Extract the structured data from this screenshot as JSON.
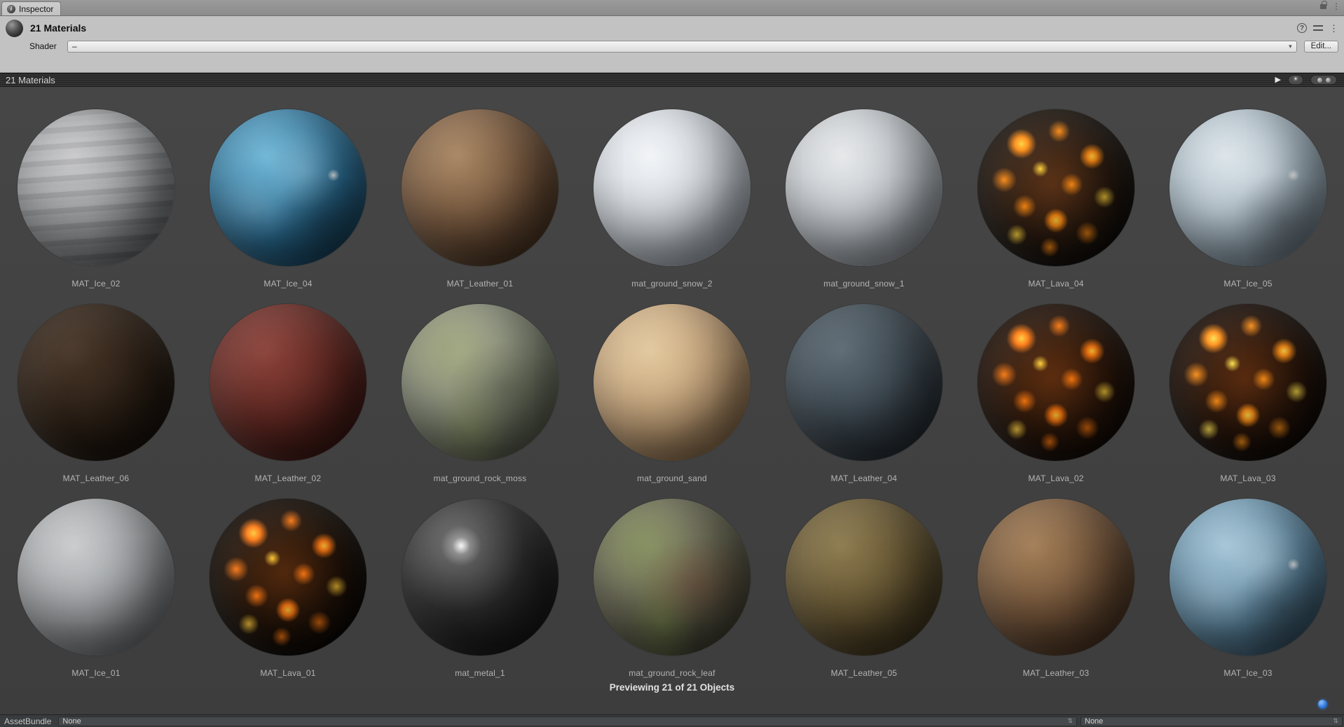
{
  "window": {
    "tab": "Inspector"
  },
  "header": {
    "title": "21 Materials",
    "shader_label": "Shader",
    "shader_value": "–",
    "edit_button": "Edit..."
  },
  "preview": {
    "title": "21 Materials",
    "status": "Previewing 21 of 21 Objects"
  },
  "assetbundle": {
    "label": "AssetBundle",
    "name_value": "None",
    "variant_value": "None"
  },
  "icons": {
    "menu": "⋮",
    "inspector_tab": "i",
    "help": "?",
    "dropdown": "▾",
    "play": "▶",
    "lighting": "☀",
    "popup": "⇅"
  },
  "colors": {
    "preview_background": "#414141",
    "header_background": "#c2c2c2",
    "splitter_background": "#2b2b2b",
    "label_text": "#b4b4b4",
    "notification_blue": "#2f7bd9"
  },
  "materials": [
    {
      "name": "MAT_Ice_02",
      "kind": "banded",
      "hi": "#c6c6c8",
      "base": "#96989a",
      "dark": "#4e5052"
    },
    {
      "name": "MAT_Ice_04",
      "kind": "marble",
      "hi": "#6fb6d6",
      "base": "#2a6c92",
      "dark": "#0e2f44"
    },
    {
      "name": "MAT_Leather_01",
      "kind": "plain",
      "hi": "#a88662",
      "base": "#70523a",
      "dark": "#352414"
    },
    {
      "name": "mat_ground_snow_2",
      "kind": "plain",
      "hi": "#f2f4f7",
      "base": "#ced4da",
      "dark": "#878e98"
    },
    {
      "name": "mat_ground_snow_1",
      "kind": "plain",
      "hi": "#e6e8ea",
      "base": "#bfc4c9",
      "dark": "#767c84"
    },
    {
      "name": "MAT_Lava_04",
      "kind": "lava",
      "hi": "#3a2f24",
      "base": "#26201a",
      "dark": "#0c0a08",
      "g1": "#ff8c14",
      "g2": "#ffd23c"
    },
    {
      "name": "MAT_Ice_05",
      "kind": "marble",
      "hi": "#dde5ea",
      "base": "#a4b6c2",
      "dark": "#5f6e7a"
    },
    {
      "name": "MAT_Leather_06",
      "kind": "plain",
      "hi": "#473527",
      "base": "#2b1f15",
      "dark": "#0f0a06"
    },
    {
      "name": "MAT_Leather_02",
      "kind": "plain",
      "hi": "#8a423a",
      "base": "#5e2620",
      "dark": "#26100c"
    },
    {
      "name": "mat_ground_rock_moss",
      "kind": "mottled",
      "hi": "#adb098",
      "base": "#7e8370",
      "dark": "#3c4034",
      "g1": "rgba(140,150,90,0.45)",
      "g2": "rgba(90,95,75,0.5)"
    },
    {
      "name": "mat_ground_sand",
      "kind": "plain",
      "hi": "#e2c89e",
      "base": "#c2a077",
      "dark": "#6b4f31"
    },
    {
      "name": "MAT_Leather_04",
      "kind": "plain",
      "hi": "#5c6a74",
      "base": "#3a454d",
      "dark": "#171d22"
    },
    {
      "name": "MAT_Lava_02",
      "kind": "lava",
      "hi": "#40220f",
      "base": "#2a1a10",
      "dark": "#0e0805",
      "g1": "#ff7a10",
      "g2": "#ffcf3e"
    },
    {
      "name": "MAT_Lava_03",
      "kind": "lava",
      "hi": "#38220f",
      "base": "#241710",
      "dark": "#0b0705",
      "g1": "#ff9018",
      "g2": "#ffe04e"
    },
    {
      "name": "MAT_Ice_01",
      "kind": "plain",
      "hi": "#c9cbcd",
      "base": "#9da0a3",
      "dark": "#54575a"
    },
    {
      "name": "MAT_Lava_01",
      "kind": "lava",
      "hi": "#2a1c10",
      "base": "#1a130d",
      "dark": "#080604",
      "g1": "#ff7a14",
      "g2": "#ffc838"
    },
    {
      "name": "mat_metal_1",
      "kind": "metal",
      "hi": "#6f6f6f",
      "base": "#2c2c2c",
      "dark": "#0d0d0d"
    },
    {
      "name": "mat_ground_rock_leaf",
      "kind": "mottled",
      "hi": "#8e8f73",
      "base": "#5f5e4a",
      "dark": "#2b2c22",
      "g1": "rgba(120,140,70,0.5)",
      "g2": "rgba(110,75,55,0.55)"
    },
    {
      "name": "MAT_Leather_05",
      "kind": "plain",
      "hi": "#8c7a4e",
      "base": "#60512f",
      "dark": "#2a2314"
    },
    {
      "name": "MAT_Leather_03",
      "kind": "plain",
      "hi": "#a37e57",
      "base": "#6f5137",
      "dark": "#332316"
    },
    {
      "name": "MAT_Ice_03",
      "kind": "marble",
      "hi": "#a6c6d8",
      "base": "#5c86a0",
      "dark": "#243a49"
    }
  ]
}
